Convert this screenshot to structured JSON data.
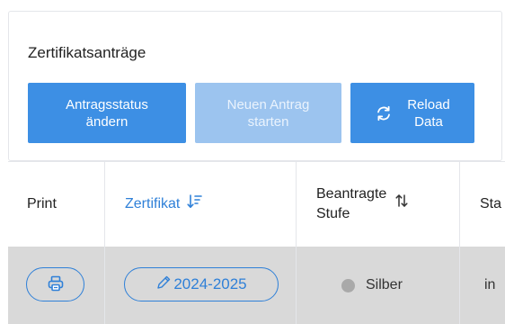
{
  "card": {
    "title": "Zertifikatsanträge",
    "buttons": {
      "status_line1": "Antragsstatus",
      "status_line2": "ändern",
      "new_line1": "Neuen Antrag",
      "new_line2": "starten",
      "reload_line1": "Reload",
      "reload_line2": "Data"
    }
  },
  "table": {
    "headers": {
      "print": "Print",
      "zertifikat": "Zertifikat",
      "stufe_line1": "Beantragte",
      "stufe_line2": "Stufe",
      "status": "Sta"
    },
    "rows": [
      {
        "zertifikat": "2024-2025",
        "stufe": "Silber",
        "status": "in"
      }
    ]
  },
  "colors": {
    "primary": "#3d8fe4",
    "primary_disabled": "#9cc4ef",
    "link": "#2f80d8",
    "row_bg": "#d9d9d9",
    "silver_dot": "#a9a9a9"
  },
  "icons": {
    "reload": "reload-icon",
    "sort_desc": "sort-down-icon",
    "sort": "sort-icon",
    "print": "printer-icon",
    "edit": "pencil-icon"
  }
}
